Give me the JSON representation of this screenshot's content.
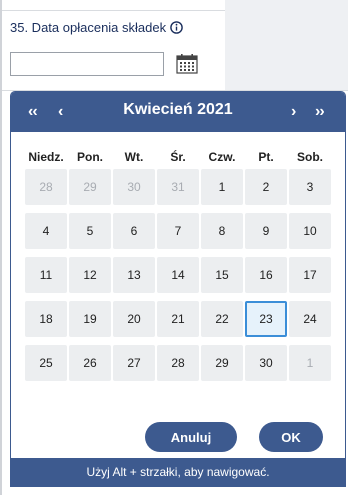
{
  "field": {
    "label": "35. Data opłacenia składek",
    "value": ""
  },
  "picker": {
    "prev_year": "‹‹",
    "prev_month": "‹",
    "next_month": "›",
    "next_year": "››",
    "title": "Kwiecień 2021",
    "weekdays": [
      "Niedz.",
      "Pon.",
      "Wt.",
      "Śr.",
      "Czw.",
      "Pt.",
      "Sob."
    ],
    "weeks": [
      [
        {
          "d": "28",
          "m": true
        },
        {
          "d": "29",
          "m": true
        },
        {
          "d": "30",
          "m": true
        },
        {
          "d": "31",
          "m": true
        },
        {
          "d": "1"
        },
        {
          "d": "2"
        },
        {
          "d": "3"
        }
      ],
      [
        {
          "d": "4"
        },
        {
          "d": "5"
        },
        {
          "d": "6"
        },
        {
          "d": "7"
        },
        {
          "d": "8"
        },
        {
          "d": "9"
        },
        {
          "d": "10"
        }
      ],
      [
        {
          "d": "11"
        },
        {
          "d": "12"
        },
        {
          "d": "13"
        },
        {
          "d": "14"
        },
        {
          "d": "15"
        },
        {
          "d": "16"
        },
        {
          "d": "17"
        }
      ],
      [
        {
          "d": "18"
        },
        {
          "d": "19"
        },
        {
          "d": "20"
        },
        {
          "d": "21"
        },
        {
          "d": "22"
        },
        {
          "d": "23",
          "s": true
        },
        {
          "d": "24"
        }
      ],
      [
        {
          "d": "25"
        },
        {
          "d": "26"
        },
        {
          "d": "27"
        },
        {
          "d": "28"
        },
        {
          "d": "29"
        },
        {
          "d": "30"
        },
        {
          "d": "1",
          "m": true
        }
      ]
    ],
    "cancel_label": "Anuluj",
    "ok_label": "OK",
    "hint": "Użyj Alt + strzałki, aby nawigować."
  },
  "colors": {
    "header": "#3d5a8f",
    "selected_border": "#3b8ed8",
    "selected_bg": "#e6f2fb",
    "cell_bg": "#eceef0"
  },
  "icons": {
    "info": "info-icon",
    "calendar": "calendar-icon"
  }
}
